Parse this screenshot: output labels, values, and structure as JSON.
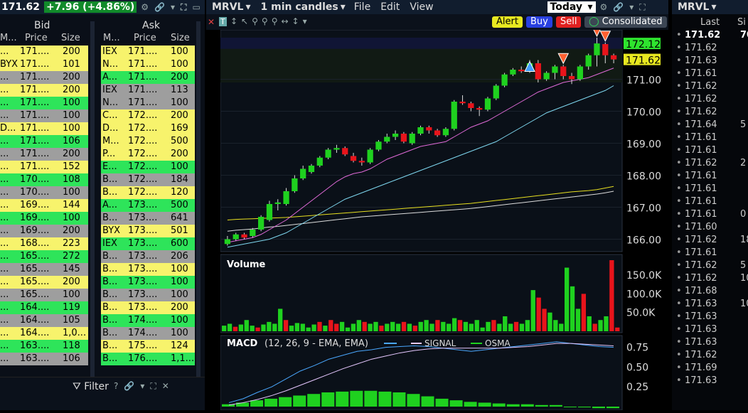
{
  "left_header": {
    "price": "171.62",
    "change": "+7.96 (+4.86%)"
  },
  "book": {
    "bid_title": "Bid",
    "ask_title": "Ask",
    "bid_cols": [
      "M...",
      "Price",
      "Size"
    ],
    "ask_cols": [
      "M...",
      "Price",
      "Size"
    ],
    "bids": [
      {
        "m": "...",
        "p": "171....",
        "s": "200",
        "c": "#f7f36c"
      },
      {
        "m": "BYX",
        "p": "171....",
        "s": "101",
        "c": "#f7f36c"
      },
      {
        "m": "...",
        "p": "171....",
        "s": "200",
        "c": "#9e9e9e"
      },
      {
        "m": "...",
        "p": "171....",
        "s": "200",
        "c": "#f7f36c"
      },
      {
        "m": "...",
        "p": "171....",
        "s": "100",
        "c": "#2ee45a"
      },
      {
        "m": "...",
        "p": "171....",
        "s": "100",
        "c": "#9e9e9e"
      },
      {
        "m": "D...",
        "p": "171....",
        "s": "100",
        "c": "#f7f36c"
      },
      {
        "m": "...",
        "p": "171....",
        "s": "106",
        "c": "#2ee45a"
      },
      {
        "m": "...",
        "p": "171....",
        "s": "200",
        "c": "#9e9e9e"
      },
      {
        "m": "...",
        "p": "171....",
        "s": "152",
        "c": "#f7f36c"
      },
      {
        "m": "...",
        "p": "170....",
        "s": "108",
        "c": "#2ee45a"
      },
      {
        "m": "...",
        "p": "170....",
        "s": "100",
        "c": "#9e9e9e"
      },
      {
        "m": "...",
        "p": "169....",
        "s": "144",
        "c": "#f7f36c"
      },
      {
        "m": "...",
        "p": "169....",
        "s": "100",
        "c": "#2ee45a"
      },
      {
        "m": "...",
        "p": "169....",
        "s": "200",
        "c": "#9e9e9e"
      },
      {
        "m": "...",
        "p": "168....",
        "s": "223",
        "c": "#f7f36c"
      },
      {
        "m": "...",
        "p": "165....",
        "s": "272",
        "c": "#2ee45a"
      },
      {
        "m": "...",
        "p": "165....",
        "s": "145",
        "c": "#9e9e9e"
      },
      {
        "m": "...",
        "p": "165....",
        "s": "200",
        "c": "#f7f36c"
      },
      {
        "m": "...",
        "p": "165....",
        "s": "100",
        "c": "#9e9e9e"
      },
      {
        "m": "...",
        "p": "164....",
        "s": "119",
        "c": "#2ee45a"
      },
      {
        "m": "...",
        "p": "164....",
        "s": "105",
        "c": "#9e9e9e"
      },
      {
        "m": "...",
        "p": "164....",
        "s": "1,0...",
        "c": "#f7f36c"
      },
      {
        "m": "...",
        "p": "163....",
        "s": "118",
        "c": "#2ee45a"
      },
      {
        "m": "...",
        "p": "163....",
        "s": "106",
        "c": "#9e9e9e"
      }
    ],
    "asks": [
      {
        "m": "IEX",
        "p": "171....",
        "s": "100",
        "c": "#f7f36c"
      },
      {
        "m": "N...",
        "p": "171....",
        "s": "100",
        "c": "#f7f36c"
      },
      {
        "m": "A...",
        "p": "171....",
        "s": "200",
        "c": "#2ee45a"
      },
      {
        "m": "IEX",
        "p": "171....",
        "s": "113",
        "c": "#9e9e9e"
      },
      {
        "m": "N...",
        "p": "171....",
        "s": "100",
        "c": "#9e9e9e"
      },
      {
        "m": "C...",
        "p": "172....",
        "s": "200",
        "c": "#f7f36c"
      },
      {
        "m": "D...",
        "p": "172....",
        "s": "169",
        "c": "#f7f36c"
      },
      {
        "m": "M...",
        "p": "172....",
        "s": "500",
        "c": "#f7f36c"
      },
      {
        "m": "P...",
        "p": "172....",
        "s": "200",
        "c": "#f7f36c"
      },
      {
        "m": "E...",
        "p": "172....",
        "s": "100",
        "c": "#2ee45a"
      },
      {
        "m": "B...",
        "p": "172....",
        "s": "184",
        "c": "#9e9e9e"
      },
      {
        "m": "B...",
        "p": "172....",
        "s": "120",
        "c": "#f7f36c"
      },
      {
        "m": "A...",
        "p": "173....",
        "s": "500",
        "c": "#2ee45a"
      },
      {
        "m": "B...",
        "p": "173....",
        "s": "641",
        "c": "#9e9e9e"
      },
      {
        "m": "BYX",
        "p": "173....",
        "s": "501",
        "c": "#f7f36c"
      },
      {
        "m": "IEX",
        "p": "173....",
        "s": "600",
        "c": "#2ee45a"
      },
      {
        "m": "B...",
        "p": "173....",
        "s": "206",
        "c": "#9e9e9e"
      },
      {
        "m": "B...",
        "p": "173....",
        "s": "100",
        "c": "#f7f36c"
      },
      {
        "m": "B...",
        "p": "173....",
        "s": "100",
        "c": "#2ee45a"
      },
      {
        "m": "B...",
        "p": "173....",
        "s": "100",
        "c": "#9e9e9e"
      },
      {
        "m": "B...",
        "p": "173....",
        "s": "200",
        "c": "#f7f36c"
      },
      {
        "m": "B...",
        "p": "174....",
        "s": "100",
        "c": "#2ee45a"
      },
      {
        "m": "B...",
        "p": "174....",
        "s": "100",
        "c": "#9e9e9e"
      },
      {
        "m": "B...",
        "p": "175....",
        "s": "124",
        "c": "#f7f36c"
      },
      {
        "m": "B...",
        "p": "176....",
        "s": "1,1...",
        "c": "#2ee45a"
      }
    ]
  },
  "filter_label": "Filter",
  "chart_header": {
    "symbol": "MRVL",
    "interval": "1 min candles",
    "menus": [
      "File",
      "Edit",
      "View"
    ],
    "period": "Today"
  },
  "toolbar": {
    "alert": "Alert",
    "buy": "Buy",
    "sell": "Sell",
    "consolidated": "Consolidated"
  },
  "price_labels": {
    "last": "172.12",
    "current": "171.62"
  },
  "price_ticks": [
    "171.00",
    "170.00",
    "169.00",
    "168.00",
    "167.00",
    "166.00"
  ],
  "volume_title": "Volume",
  "volume_ticks": [
    "150.0K",
    "100.0K",
    "50.0K"
  ],
  "macd_title": "MACD",
  "macd_params": "(12, 26, 9 - EMA, EMA)",
  "macd_signal": "SIGNAL",
  "macd_osma": "OSMA",
  "macd_ticks": [
    "0.75",
    "0.50",
    "0.25"
  ],
  "colors": {
    "up": "#1fd11f",
    "down": "#e8141b",
    "ema_fast": "#e06ad8",
    "ema_slow": "#7fd8f0"
  },
  "right_panel": {
    "symbol": "MRVL",
    "cols": [
      "Last",
      "Si"
    ],
    "first": "171.62",
    "first_size": "70",
    "rows": [
      "171.62",
      "171.63",
      "171.61",
      "171.62",
      "171.62",
      "171.62",
      "171.64",
      "171.61",
      "171.61",
      "171.62",
      "171.61",
      "171.61",
      "171.61",
      "171.61",
      "171.60",
      "171.62",
      "171.61",
      "171.62",
      "171.62",
      "171.68",
      "171.63",
      "171.63",
      "171.63",
      "171.63",
      "171.62",
      "171.69",
      "171.63"
    ],
    "sizes": [
      "",
      "",
      "",
      "",
      "",
      "",
      "5",
      "",
      "",
      "2",
      "",
      "",
      "",
      "0",
      "",
      "18",
      "",
      "5",
      "10",
      "",
      "10",
      "",
      "",
      "",
      "",
      "",
      ""
    ]
  },
  "chart_data": [
    {
      "type": "candlestick",
      "title": "MRVL 1 min candles",
      "ylim": [
        165.7,
        172.5
      ],
      "candles": [
        {
          "o": 165.85,
          "c": 166.0,
          "h": 166.1,
          "l": 165.8
        },
        {
          "o": 166.0,
          "c": 166.15,
          "h": 166.2,
          "l": 165.95
        },
        {
          "o": 166.15,
          "c": 166.05,
          "h": 166.2,
          "l": 166.0
        },
        {
          "o": 166.1,
          "c": 166.3,
          "h": 166.35,
          "l": 166.05
        },
        {
          "o": 166.3,
          "c": 166.7,
          "h": 166.75,
          "l": 166.25
        },
        {
          "o": 166.6,
          "c": 167.1,
          "h": 167.2,
          "l": 166.55
        },
        {
          "o": 167.1,
          "c": 167.15,
          "h": 167.25,
          "l": 166.9
        },
        {
          "o": 167.1,
          "c": 167.5,
          "h": 167.6,
          "l": 167.05
        },
        {
          "o": 167.5,
          "c": 167.9,
          "h": 168.0,
          "l": 167.45
        },
        {
          "o": 167.9,
          "c": 168.2,
          "h": 168.3,
          "l": 167.85
        },
        {
          "o": 168.1,
          "c": 168.3,
          "h": 168.35,
          "l": 168.05
        },
        {
          "o": 168.3,
          "c": 168.55,
          "h": 168.6,
          "l": 168.25
        },
        {
          "o": 168.55,
          "c": 168.8,
          "h": 168.85,
          "l": 168.5
        },
        {
          "o": 168.8,
          "c": 168.85,
          "h": 168.95,
          "l": 168.7
        },
        {
          "o": 168.85,
          "c": 168.65,
          "h": 168.9,
          "l": 168.6
        },
        {
          "o": 168.6,
          "c": 168.45,
          "h": 168.7,
          "l": 168.4
        },
        {
          "o": 168.45,
          "c": 168.4,
          "h": 168.55,
          "l": 168.3
        },
        {
          "o": 168.4,
          "c": 168.8,
          "h": 168.85,
          "l": 168.35
        },
        {
          "o": 168.8,
          "c": 169.05,
          "h": 169.1,
          "l": 168.75
        },
        {
          "o": 169.05,
          "c": 169.2,
          "h": 169.3,
          "l": 169.0
        },
        {
          "o": 169.2,
          "c": 169.3,
          "h": 169.4,
          "l": 169.1
        },
        {
          "o": 169.3,
          "c": 169.05,
          "h": 169.35,
          "l": 169.0
        },
        {
          "o": 169.0,
          "c": 169.3,
          "h": 169.35,
          "l": 168.95
        },
        {
          "o": 169.3,
          "c": 169.5,
          "h": 169.55,
          "l": 169.25
        },
        {
          "o": 169.5,
          "c": 169.4,
          "h": 169.55,
          "l": 169.3
        },
        {
          "o": 169.4,
          "c": 169.25,
          "h": 169.45,
          "l": 169.2
        },
        {
          "o": 169.25,
          "c": 169.45,
          "h": 169.5,
          "l": 169.2
        },
        {
          "o": 169.45,
          "c": 170.3,
          "h": 170.35,
          "l": 169.4
        },
        {
          "o": 170.3,
          "c": 170.25,
          "h": 170.5,
          "l": 170.2
        },
        {
          "o": 170.25,
          "c": 170.1,
          "h": 170.3,
          "l": 170.0
        },
        {
          "o": 170.1,
          "c": 170.05,
          "h": 170.15,
          "l": 169.85
        },
        {
          "o": 170.05,
          "c": 170.4,
          "h": 170.45,
          "l": 170.0
        },
        {
          "o": 170.4,
          "c": 170.8,
          "h": 170.85,
          "l": 170.35
        },
        {
          "o": 170.8,
          "c": 171.15,
          "h": 171.2,
          "l": 170.75
        },
        {
          "o": 171.15,
          "c": 171.3,
          "h": 171.35,
          "l": 171.1
        },
        {
          "o": 171.3,
          "c": 171.25,
          "h": 171.4,
          "l": 171.2
        },
        {
          "o": 171.25,
          "c": 171.5,
          "h": 171.6,
          "l": 171.2
        },
        {
          "o": 171.5,
          "c": 171.0,
          "h": 171.6,
          "l": 170.9
        },
        {
          "o": 171.0,
          "c": 171.2,
          "h": 171.25,
          "l": 170.95
        },
        {
          "o": 171.2,
          "c": 171.4,
          "h": 171.45,
          "l": 171.0
        },
        {
          "o": 171.4,
          "c": 171.1,
          "h": 171.45,
          "l": 171.0
        },
        {
          "o": 171.1,
          "c": 171.0,
          "h": 171.2,
          "l": 170.85
        },
        {
          "o": 171.0,
          "c": 171.4,
          "h": 171.45,
          "l": 170.95
        },
        {
          "o": 171.4,
          "c": 171.75,
          "h": 171.8,
          "l": 171.3
        },
        {
          "o": 171.75,
          "c": 172.12,
          "h": 172.3,
          "l": 171.4
        },
        {
          "o": 172.1,
          "c": 171.75,
          "h": 172.15,
          "l": 171.5
        },
        {
          "o": 171.75,
          "c": 171.62,
          "h": 171.8,
          "l": 171.5
        }
      ],
      "ema_fast": [
        165.9,
        165.95,
        166.0,
        166.05,
        166.15,
        166.3,
        166.45,
        166.6,
        166.8,
        167.0,
        167.2,
        167.4,
        167.6,
        167.8,
        167.95,
        168.05,
        168.1,
        168.2,
        168.35,
        168.5,
        168.6,
        168.7,
        168.8,
        168.9,
        168.95,
        169.0,
        169.05,
        169.2,
        169.35,
        169.5,
        169.6,
        169.7,
        169.85,
        170.0,
        170.15,
        170.3,
        170.45,
        170.6,
        170.7,
        170.8,
        170.9,
        170.95,
        171.0,
        171.05,
        171.15,
        171.25,
        171.35
      ],
      "ema_slow": [
        165.75,
        165.8,
        165.85,
        165.9,
        165.95,
        166.0,
        166.1,
        166.2,
        166.35,
        166.5,
        166.65,
        166.8,
        166.95,
        167.1,
        167.25,
        167.35,
        167.45,
        167.55,
        167.65,
        167.75,
        167.85,
        167.95,
        168.05,
        168.15,
        168.25,
        168.35,
        168.45,
        168.55,
        168.65,
        168.75,
        168.85,
        168.95,
        169.05,
        169.2,
        169.35,
        169.5,
        169.65,
        169.8,
        169.95,
        170.05,
        170.15,
        170.25,
        170.35,
        170.45,
        170.55,
        170.65,
        170.8
      ],
      "ma_yellow": [
        166.6,
        166.62,
        166.63,
        166.64,
        166.65,
        166.66,
        166.67,
        166.68,
        166.7,
        166.72,
        166.74,
        166.76,
        166.78,
        166.8,
        166.82,
        166.84,
        166.86,
        166.88,
        166.9,
        166.92,
        166.94,
        166.96,
        166.98,
        167.0,
        167.02,
        167.04,
        167.06,
        167.08,
        167.1,
        167.12,
        167.15,
        167.18,
        167.21,
        167.24,
        167.27,
        167.3,
        167.33,
        167.36,
        167.39,
        167.42,
        167.45,
        167.48,
        167.5,
        167.52,
        167.55,
        167.6,
        167.65
      ],
      "ma_white": [
        166.25,
        166.28,
        166.3,
        166.32,
        166.35,
        166.38,
        166.4,
        166.43,
        166.46,
        166.49,
        166.52,
        166.55,
        166.58,
        166.61,
        166.64,
        166.67,
        166.7,
        166.72,
        166.74,
        166.76,
        166.78,
        166.8,
        166.82,
        166.84,
        166.86,
        166.88,
        166.9,
        166.92,
        166.94,
        166.96,
        166.99,
        167.02,
        167.05,
        167.08,
        167.11,
        167.14,
        167.17,
        167.2,
        167.23,
        167.26,
        167.29,
        167.32,
        167.35,
        167.38,
        167.41,
        167.45,
        167.5
      ],
      "signals": [
        {
          "i": 36,
          "type": "buy"
        },
        {
          "i": 40,
          "type": "sell"
        },
        {
          "i": 44,
          "type": "sell"
        },
        {
          "i": 45,
          "type": "sell"
        }
      ]
    },
    {
      "type": "bar",
      "title": "Volume",
      "ylim": [
        0,
        190000
      ],
      "values": [
        15000,
        20000,
        12000,
        18000,
        30000,
        15000,
        10000,
        18000,
        25000,
        20000,
        60000,
        30000,
        15000,
        22000,
        20000,
        10000,
        18000,
        25000,
        15000,
        30000,
        20000,
        25000,
        10000,
        20000,
        30000,
        25000,
        20000,
        25000,
        15000,
        20000,
        25000,
        20000,
        25000,
        20000,
        15000,
        25000,
        30000,
        20000,
        30000,
        25000,
        20000,
        35000,
        30000,
        25000,
        20000,
        30000,
        10000,
        25000,
        30000,
        20000,
        40000,
        20000,
        25000,
        20000,
        30000,
        110000,
        90000,
        60000,
        50000,
        30000,
        20000,
        170000,
        120000,
        60000,
        100000,
        40000,
        20000,
        30000,
        40000,
        190000,
        10000
      ],
      "up": [
        1,
        1,
        0,
        1,
        1,
        1,
        0,
        1,
        1,
        1,
        1,
        0,
        1,
        1,
        1,
        1,
        1,
        0,
        1,
        0,
        0,
        1,
        1,
        1,
        1,
        0,
        1,
        1,
        0,
        1,
        1,
        1,
        0,
        1,
        0,
        1,
        1,
        1,
        0,
        1,
        1,
        1,
        0,
        1,
        1,
        1,
        1,
        1,
        0,
        1,
        1,
        1,
        0,
        1,
        1,
        1,
        0,
        0,
        1,
        1,
        1,
        1,
        1,
        1,
        0,
        1,
        0,
        1,
        1,
        0,
        0
      ]
    },
    {
      "type": "line",
      "title": "MACD",
      "ylim": [
        0,
        0.9
      ],
      "macd": [
        0.05,
        0.1,
        0.18,
        0.25,
        0.35,
        0.45,
        0.52,
        0.6,
        0.65,
        0.7,
        0.72,
        0.75,
        0.76,
        0.77,
        0.76,
        0.74,
        0.72,
        0.7,
        0.72,
        0.74,
        0.76,
        0.78,
        0.8,
        0.82,
        0.8,
        0.78,
        0.76,
        0.75
      ],
      "signal": [
        0.02,
        0.05,
        0.09,
        0.14,
        0.2,
        0.27,
        0.34,
        0.41,
        0.48,
        0.54,
        0.6,
        0.64,
        0.68,
        0.71,
        0.73,
        0.74,
        0.74,
        0.74,
        0.74,
        0.74,
        0.75,
        0.76,
        0.78,
        0.8,
        0.8,
        0.79,
        0.78,
        0.77
      ],
      "osma": [
        0.03,
        0.05,
        0.08,
        0.1,
        0.12,
        0.14,
        0.16,
        0.18,
        0.19,
        0.2,
        0.2,
        0.19,
        0.18,
        0.16,
        0.13,
        0.1,
        0.08,
        0.06,
        0.05,
        0.04,
        0.03,
        0.03,
        0.02,
        0.02,
        0.0,
        -0.01,
        -0.02,
        -0.02
      ]
    }
  ]
}
